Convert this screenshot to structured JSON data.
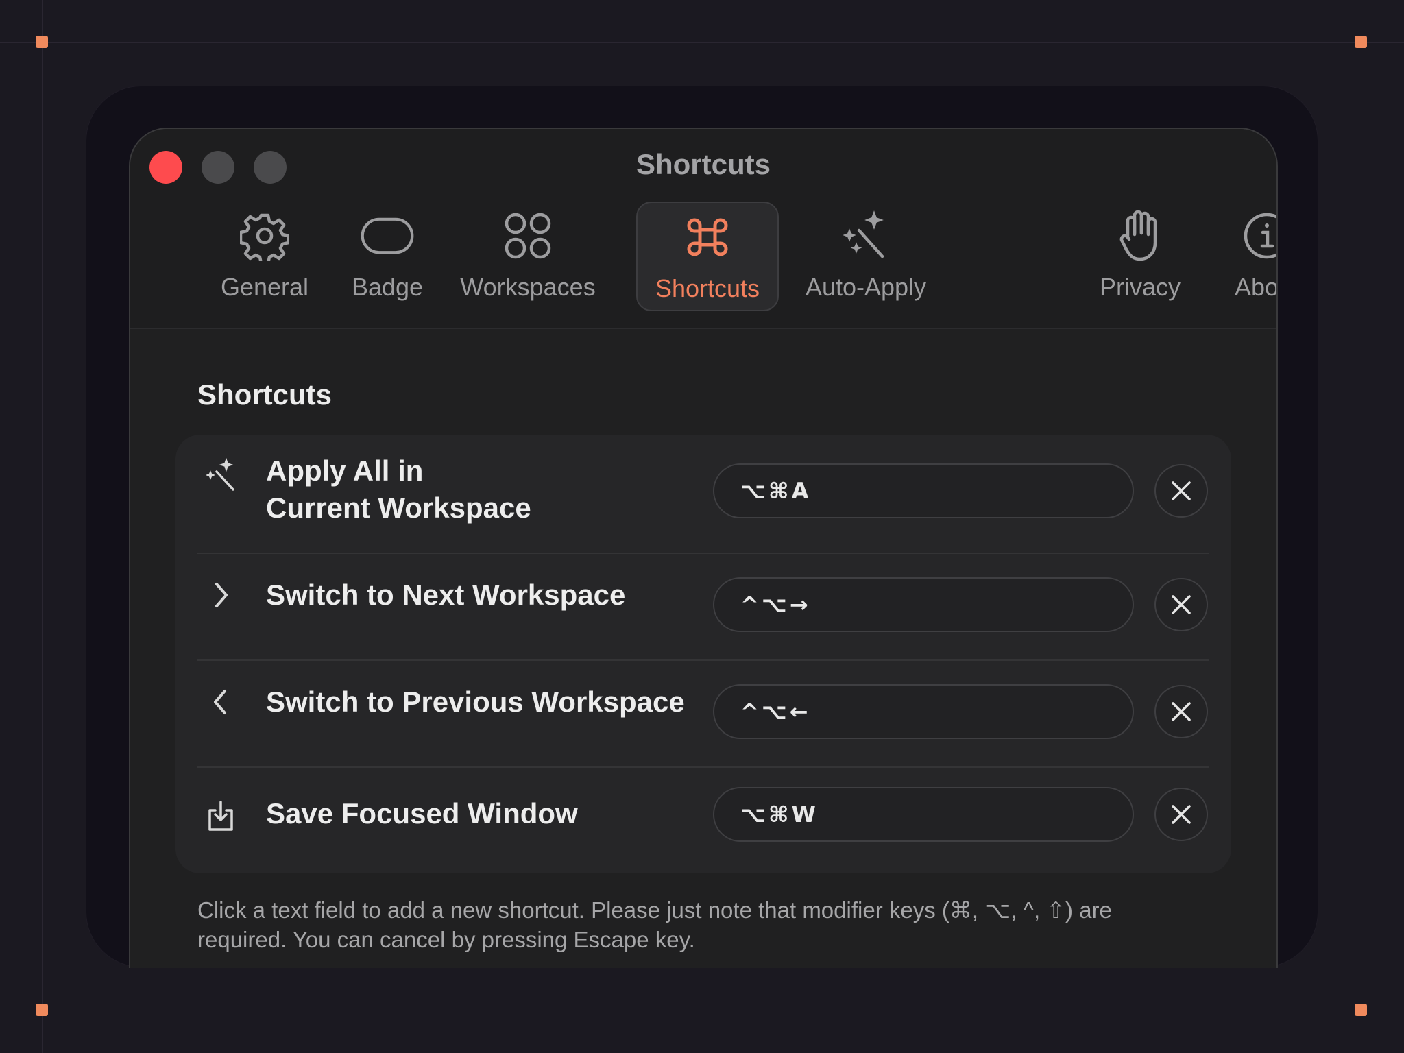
{
  "window": {
    "title": "Shortcuts"
  },
  "tabs": [
    {
      "label": "General",
      "icon": "gear-icon"
    },
    {
      "label": "Badge",
      "icon": "badge-icon"
    },
    {
      "label": "Workspaces",
      "icon": "workspaces-icon"
    },
    {
      "label": "Shortcuts",
      "icon": "command-icon",
      "active": true
    },
    {
      "label": "Auto-Apply",
      "icon": "magic-wand-icon"
    },
    {
      "label": "Privacy",
      "icon": "hand-icon"
    },
    {
      "label": "About",
      "icon": "info-icon"
    }
  ],
  "section": {
    "title": "Shortcuts"
  },
  "shortcuts": [
    {
      "label_line1": "Apply All in",
      "label_line2": "Current Workspace",
      "keys": "⌥⌘A",
      "icon": "magic-wand-icon"
    },
    {
      "label": "Switch to Next Workspace",
      "keys": "^⌥→",
      "icon": "chevron-right-icon"
    },
    {
      "label": "Switch to Previous Workspace",
      "keys": "^⌥←",
      "icon": "chevron-left-icon"
    },
    {
      "label": "Save Focused Window",
      "keys": "⌥⌘W",
      "icon": "save-icon"
    }
  ],
  "footer": {
    "line1": "Click a text field to add a new shortcut. Please just note that modifier keys (⌘, ⌥, ^, ⇧) are",
    "line2": "required. You can cancel by pressing Escape key."
  },
  "colors": {
    "accent": "#f2805d",
    "close": "#fe4b4e",
    "background": "#1b1921"
  }
}
